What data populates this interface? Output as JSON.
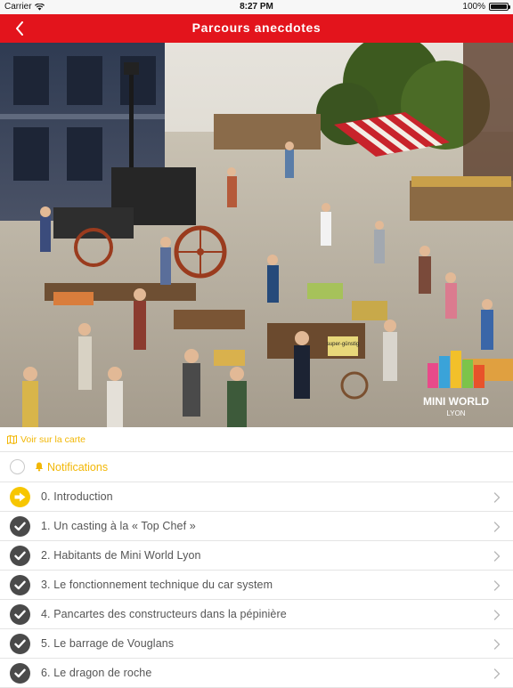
{
  "status_bar": {
    "carrier": "Carrier",
    "time": "8:27 PM",
    "battery": "100%",
    "battery_level": 1.0
  },
  "nav": {
    "title": "Parcours anecdotes",
    "back_icon": "chevron-left-icon"
  },
  "hero": {
    "logo_text": "MINI WORLD",
    "logo_subtext": "LYON",
    "sign_text": "super-günstig"
  },
  "map_link": {
    "label": "Voir sur la carte",
    "icon": "map-icon"
  },
  "notifications": {
    "label": "Notifications",
    "icon": "bell-icon",
    "enabled": false
  },
  "items": [
    {
      "label": "0. Introduction",
      "status": "current"
    },
    {
      "label": "1. Un casting à la « Top Chef »",
      "status": "done"
    },
    {
      "label": "2. Habitants de Mini World Lyon",
      "status": "done"
    },
    {
      "label": "3. Le fonctionnement technique du car system",
      "status": "done"
    },
    {
      "label": "4. Pancartes des constructeurs dans la pépinière",
      "status": "done"
    },
    {
      "label": "5. Le barrage de Vouglans",
      "status": "done"
    },
    {
      "label": "6. Le dragon de roche",
      "status": "done"
    }
  ],
  "colors": {
    "brand_red": "#e3141c",
    "accent_yellow": "#f2b705",
    "done_gray": "#4a4a4a"
  }
}
